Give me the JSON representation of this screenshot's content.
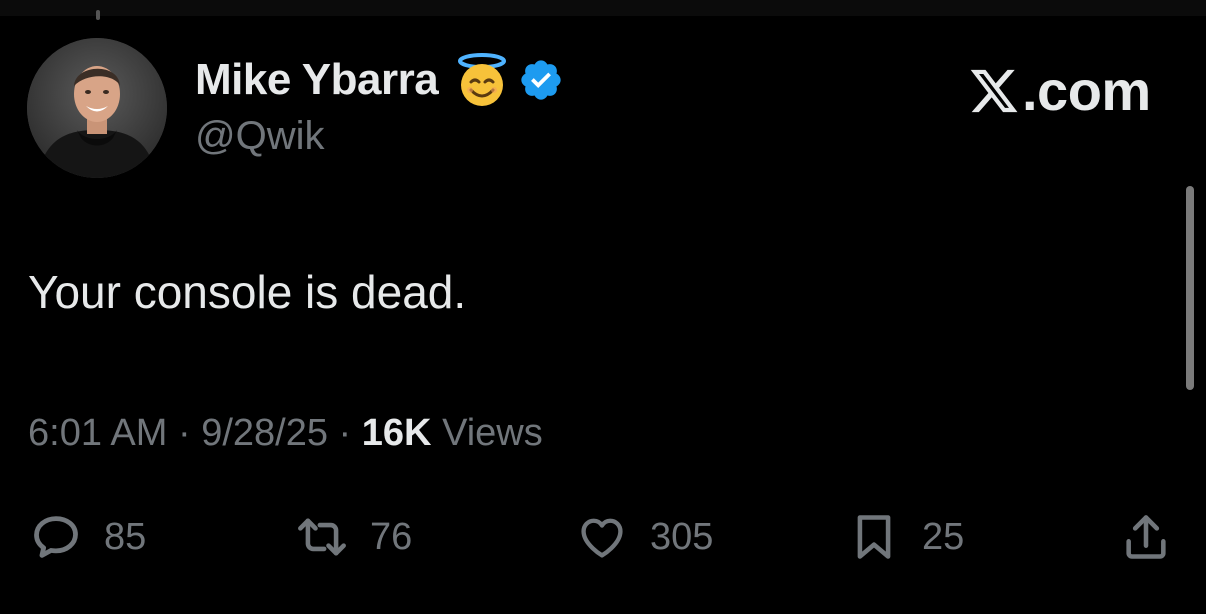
{
  "header": {
    "display_name": "Mike Ybarra",
    "handle": "@Qwik",
    "brand": ".com"
  },
  "tweet": {
    "text": "Your console is dead.",
    "time": "6:01 AM",
    "date": "9/28/25",
    "views_count": "16K",
    "views_label": "Views"
  },
  "actions": {
    "replies": "85",
    "reposts": "76",
    "likes": "305",
    "bookmarks": "25"
  },
  "icons": {
    "emoji": "smiling-face-with-halo-icon",
    "verified": "verified-badge-icon",
    "brand_logo": "x-logo-icon"
  },
  "colors": {
    "background": "#000000",
    "text_primary": "#e7e9ea",
    "text_secondary": "#71767b",
    "verified_blue": "#1d9bf0",
    "emoji_yellow": "#f7c23a"
  }
}
